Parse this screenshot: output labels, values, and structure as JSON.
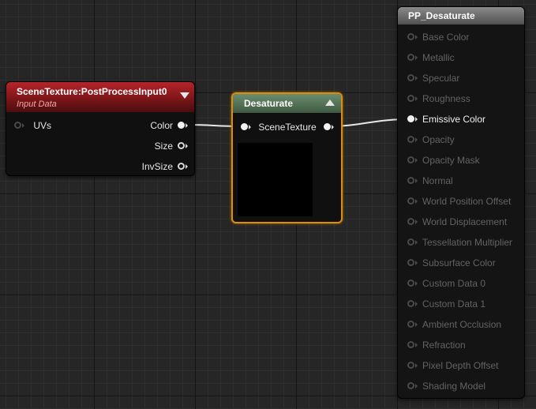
{
  "nodes": {
    "scene_texture": {
      "title": "SceneTexture:PostProcessInput0",
      "subtitle": "Input Data",
      "input_pins": [
        {
          "label": "UVs",
          "connected": false
        }
      ],
      "output_pins": [
        {
          "label": "Color",
          "connected": true
        },
        {
          "label": "Size",
          "connected": false
        },
        {
          "label": "InvSize",
          "connected": false
        }
      ]
    },
    "desaturate": {
      "title": "Desaturate",
      "input_label": "SceneTexture",
      "selected": true,
      "selection_color": "#d98d12"
    },
    "result": {
      "title": "PP_Desaturate",
      "inputs": [
        {
          "label": "Base Color",
          "active": false
        },
        {
          "label": "Metallic",
          "active": false
        },
        {
          "label": "Specular",
          "active": false
        },
        {
          "label": "Roughness",
          "active": false
        },
        {
          "label": "Emissive Color",
          "active": true
        },
        {
          "label": "Opacity",
          "active": false
        },
        {
          "label": "Opacity Mask",
          "active": false
        },
        {
          "label": "Normal",
          "active": false
        },
        {
          "label": "World Position Offset",
          "active": false
        },
        {
          "label": "World Displacement",
          "active": false
        },
        {
          "label": "Tessellation Multiplier",
          "active": false
        },
        {
          "label": "Subsurface Color",
          "active": false
        },
        {
          "label": "Custom Data 0",
          "active": false
        },
        {
          "label": "Custom Data 1",
          "active": false
        },
        {
          "label": "Ambient Occlusion",
          "active": false
        },
        {
          "label": "Refraction",
          "active": false
        },
        {
          "label": "Pixel Depth Offset",
          "active": false
        },
        {
          "label": "Shading Model",
          "active": false
        }
      ]
    }
  },
  "colors": {
    "graph_background": "#262626",
    "scene_header": "#b5242a",
    "desaturate_header": "#5b7d5e",
    "result_header": "#6e6e6e",
    "wire": "#e8e8e8"
  },
  "icons": {
    "collapse_down": "triangle-down-icon",
    "collapse_up": "triangle-up-icon",
    "pin": "pin-circle-icon"
  }
}
